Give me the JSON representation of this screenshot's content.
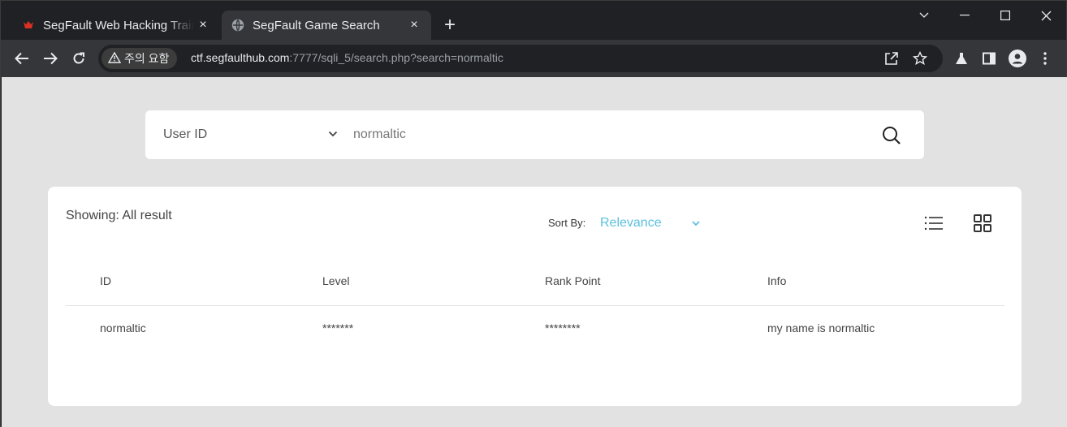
{
  "browser": {
    "tabs": [
      {
        "title": "SegFault Web Hacking Traini",
        "favicon": "segfault-logo-icon",
        "close": "×"
      },
      {
        "title": "SegFault Game Search",
        "favicon": "globe-icon",
        "close": "×",
        "active": true
      }
    ],
    "new_tab": "+",
    "security_chip": "주의 요함",
    "url_host": "ctf.segfaulthub.com",
    "url_rest": ":7777/sqli_5/search.php?search=normaltic",
    "colors": {
      "frame": "#202124",
      "toolbar": "#35363a",
      "text": "#e8eaed",
      "muted": "#9aa0a6"
    }
  },
  "search": {
    "filter_label": "User ID",
    "query": "normaltic"
  },
  "results_panel": {
    "showing": "Showing: All result",
    "sort_by_label": "Sort By:",
    "sort_value": "Relevance",
    "accent": "#5bc0de",
    "columns": [
      "ID",
      "Level",
      "Rank Point",
      "Info"
    ],
    "rows": [
      [
        "normaltic",
        "*******",
        "********",
        "my name is normaltic"
      ]
    ]
  }
}
